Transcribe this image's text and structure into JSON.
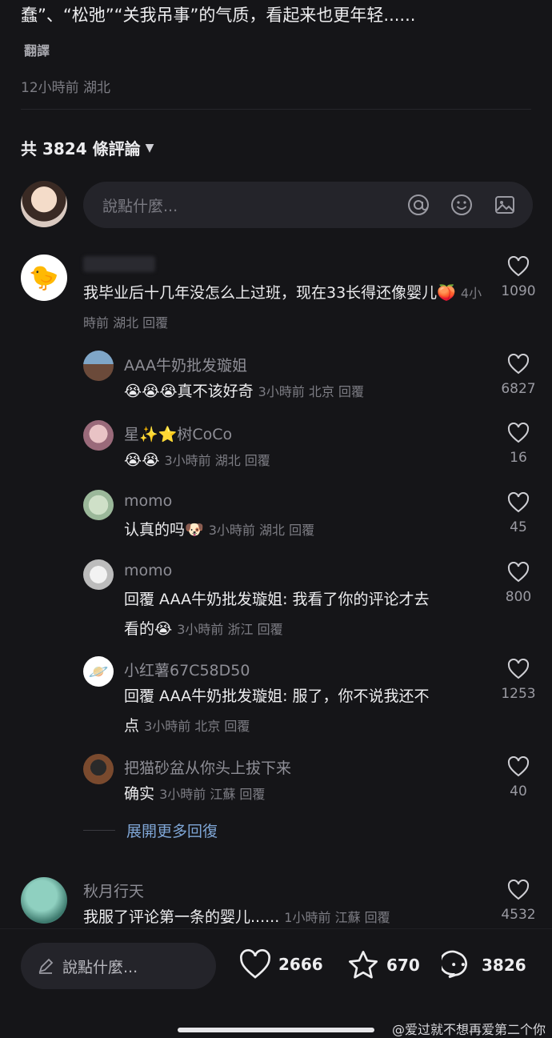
{
  "post": {
    "text_tail": "蠢”、“松弛”“关我吊事”的气质，看起来也更年轻......",
    "translate_label": "翻譯",
    "meta": "12小時前 湖北"
  },
  "comments_header": {
    "count_label": "共 3824 條評論"
  },
  "composer": {
    "placeholder": "說點什麼..."
  },
  "comments": [
    {
      "name": "",
      "text": "我毕业后十几年没怎么上过班，现在33长得还像婴儿",
      "emoji": "🍑",
      "meta": "4小時前 湖北 回覆",
      "likes": "1090"
    },
    {
      "name": "AAA牛奶批发璇姐",
      "text": "😭😭😭真不该好奇",
      "meta": "3小時前 北京 回覆",
      "likes": "6827"
    },
    {
      "name": "星✨⭐树CoCo",
      "text": "😭😭",
      "meta": "3小時前 湖北 回覆",
      "likes": "16"
    },
    {
      "name": "momo",
      "text": "认真的吗",
      "emoji": "🐶",
      "meta": "3小時前 湖北 回覆",
      "likes": "45"
    },
    {
      "name": "momo",
      "text_line1": "回覆 AAA牛奶批发璇姐: 我看了你的评论才去",
      "text_line2": "看的😭",
      "meta": "3小時前 浙江 回覆",
      "likes": "800"
    },
    {
      "name": "小红薯67C58D50",
      "text_line1": "回覆 AAA牛奶批发璇姐: 服了，你不说我还不",
      "text_line2": "点",
      "meta": "3小時前 北京 回覆",
      "likes": "1253"
    },
    {
      "name": "把猫砂盆从你头上拔下来",
      "text": "确实",
      "meta": "3小時前 江蘇 回覆",
      "likes": "40"
    },
    {
      "name": "秋月行天",
      "text": "我服了评论第一条的婴儿......",
      "meta": "1小時前 江蘇 回覆",
      "likes": "4532"
    }
  ],
  "expand_more": "展開更多回復",
  "bottom": {
    "placeholder": "說點什麼...",
    "likes": "2666",
    "favorites": "670",
    "comments": "3826"
  },
  "watermark": "@爱过就不想再爱第二个你",
  "icons": {
    "heart": "heart-icon",
    "star": "star-icon",
    "comment": "comment-bubble-icon",
    "mention": "at-icon",
    "emoji": "smile-icon",
    "image": "image-icon",
    "pencil": "pencil-icon"
  }
}
